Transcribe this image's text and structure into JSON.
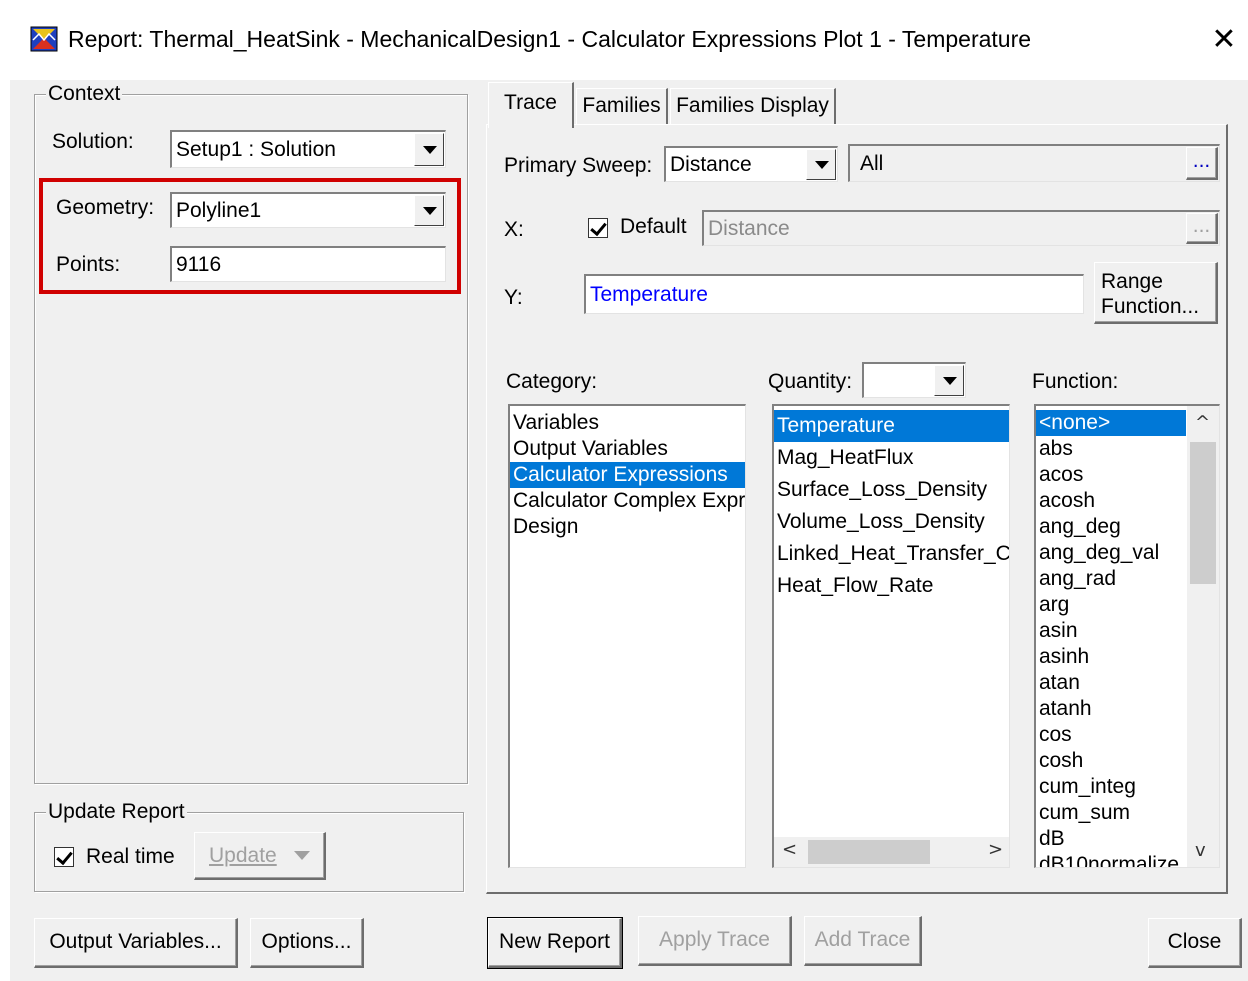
{
  "window": {
    "title": "Report: Thermal_HeatSink - MechanicalDesign1 - Calculator Expressions Plot 1 - Temperature",
    "close_glyph": "✕"
  },
  "context": {
    "group_label": "Context",
    "solution_label": "Solution:",
    "solution_value": "Setup1 : Solution",
    "geometry_label": "Geometry:",
    "geometry_value": "Polyline1",
    "points_label": "Points:",
    "points_value": "9116"
  },
  "update_report": {
    "group_label": "Update Report",
    "realtime_label": "Real time",
    "realtime_checked": true,
    "update_button": "Update"
  },
  "tabs": [
    {
      "label": "Trace",
      "active": true
    },
    {
      "label": "Families",
      "active": false
    },
    {
      "label": "Families Display",
      "active": false
    }
  ],
  "trace": {
    "primary_sweep_label": "Primary Sweep:",
    "primary_sweep_value": "Distance",
    "sweep_range_value": "All",
    "ellipsis": "...",
    "x_label": "X:",
    "default_label": "Default",
    "default_checked": true,
    "x_value": "Distance",
    "y_label": "Y:",
    "y_value": "Temperature",
    "range_function_line1": "Range",
    "range_function_line2": "Function...",
    "category_label": "Category:",
    "quantity_label": "Quantity:",
    "function_label": "Function:",
    "categories": [
      "Variables",
      "Output Variables",
      "Calculator Expressions",
      "Calculator Complex Expre",
      "Design"
    ],
    "category_selected": 2,
    "quantities": [
      "Temperature",
      "Mag_HeatFlux",
      "Surface_Loss_Density",
      "Volume_Loss_Density",
      "Linked_Heat_Transfer_C",
      "Heat_Flow_Rate"
    ],
    "quantity_selected": 0,
    "functions": [
      "<none>",
      "abs",
      "acos",
      "acosh",
      "ang_deg",
      "ang_deg_val",
      "ang_rad",
      "arg",
      "asin",
      "asinh",
      "atan",
      "atanh",
      "cos",
      "cosh",
      "cum_integ",
      "cum_sum",
      "dB",
      "dB10normalize"
    ],
    "function_selected": 0
  },
  "buttons": {
    "output_variables": "Output Variables...",
    "options": "Options...",
    "new_report": "New Report",
    "apply_trace": "Apply Trace",
    "add_trace": "Add Trace",
    "close": "Close"
  },
  "colors": {
    "selection": "#0078d7",
    "highlight_box": "#d00000",
    "y_text": "#0000ff"
  }
}
